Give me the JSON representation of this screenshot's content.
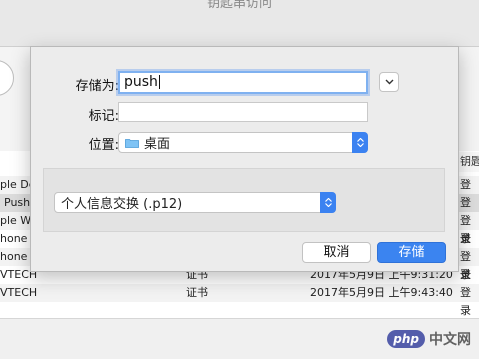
{
  "background": {
    "window_title": "钥匙串访问",
    "header_right": "钥匙",
    "rows": [
      {
        "name": "ple Dev",
        "kind": "",
        "date": "",
        "keychain": "登录"
      },
      {
        "name": "Push",
        "kind": "",
        "date": "",
        "keychain": "登录"
      },
      {
        "name": "ple Wo",
        "kind": "",
        "date": "",
        "keychain": "登录"
      },
      {
        "name": "hone D",
        "kind": "",
        "date": "",
        "keychain": "登录"
      },
      {
        "name": "hone D",
        "kind": "",
        "date": "",
        "keychain": "登录"
      },
      {
        "name": "VTECH",
        "kind": "证书",
        "date": "2017年5月9日 上午9:31:20",
        "keychain": "登录"
      },
      {
        "name": "VTECH",
        "kind": "证书",
        "date": "2017年5月9日 上午9:43:40",
        "keychain": "登录"
      }
    ]
  },
  "dialog": {
    "save_as_label": "存储为:",
    "save_as_value": "push",
    "tags_label": "标记:",
    "tags_value": "",
    "location_label": "位置:",
    "location_value": "桌面",
    "format_value": "个人信息交换 (.p12)",
    "cancel_label": "取消",
    "save_label": "存储"
  },
  "watermark": {
    "php": "php",
    "text": "中文网"
  },
  "colors": {
    "accent": "#3b84f0",
    "dialog_bg": "#ececec",
    "focus_ring": "#7fb1f0"
  }
}
